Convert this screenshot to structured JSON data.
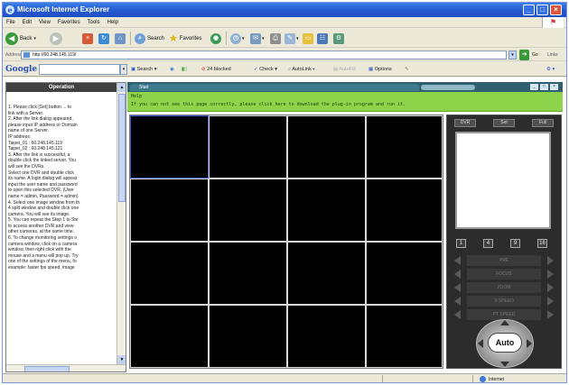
{
  "window": {
    "title": "Microsoft Internet Explorer",
    "min_label": "_",
    "max_label": "□",
    "close_label": "×"
  },
  "menu": [
    "File",
    "Edit",
    "View",
    "Favorites",
    "Tools",
    "Help"
  ],
  "toolbar": {
    "back": "Back",
    "search": "Search",
    "favorites": "Favorites"
  },
  "address": {
    "label": "Address",
    "value": "http://60.248.145.119/",
    "go": "Go",
    "links": "Links"
  },
  "google": {
    "logo": "Google",
    "search": "Search",
    "blocked": "24 blocked",
    "check": "Check",
    "autolink": "AutoLink",
    "autofill": "AutoFill",
    "options": "Options"
  },
  "panel": {
    "title": "Operation",
    "lines": [
      "1. Please click [Set] button ... to",
      "link with a Server.",
      "2. After the link dialog appeared,",
      "please input IP address or Domain",
      "name of one Server.",
      "   IP address:",
      "   Taipei_01 : 60.248.145.119",
      "   Taipei_02 : 60.248.145.121",
      "3. After the link is successful, a",
      "double click the linked server. You",
      "will see the DVRs.",
      "   Select one DVR and double click",
      "its name. A login dialog will appear",
      "input the user name and password",
      "to open this selected DVR. (User",
      "name = admin, Password = admin)",
      "4. Select one image window from th",
      "4 split window and double click one",
      "camera. You will see its image.",
      "5. You can repeat the Step 1 to Ste",
      "to access another DVR and view",
      "other cameras, at the same time.",
      "6. To change monitoring settings o",
      "camera window, click on a camera",
      "window, then right click with the",
      "mouse and a menu will pop up. Try",
      "one of the settings of the menu, fo",
      "example: faster fps speed, image"
    ]
  },
  "viewer": {
    "tab": "Start",
    "help": "Help",
    "notice": "If you can not see this page correctly, please click here to download the plug-in program and run it.",
    "ptz_top": [
      "DVR",
      "Set",
      "Full"
    ],
    "layouts": [
      "1",
      "4",
      "9",
      "16"
    ],
    "rows": [
      "PRE",
      "FOCUS",
      "ZOOM",
      "X SPEED",
      "PT SPEED"
    ],
    "auto": "Auto"
  },
  "status": {
    "zone": "Internet"
  },
  "colors": {
    "title_bar": "#2557d0",
    "notice_bar": "#8ed44a",
    "grid_bg": "#000000",
    "ptz_bg": "#2c2c2c"
  }
}
